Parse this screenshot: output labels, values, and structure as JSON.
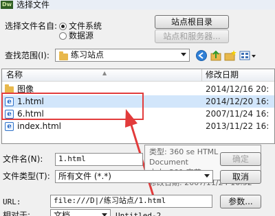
{
  "window": {
    "app_icon": "Dw",
    "title": "选择文件"
  },
  "source": {
    "label": "选择文件名自:",
    "options": [
      "文件系统",
      "数据源"
    ],
    "selected": 0,
    "site_root_button": "站点根目录",
    "site_server_button": "站点和服务器..."
  },
  "lookin": {
    "label": "查找范围(I):",
    "value": "练习站点"
  },
  "toolbar": {
    "icons": [
      "back-icon",
      "up-folder-icon",
      "new-folder-icon",
      "view-menu-icon"
    ]
  },
  "list": {
    "columns": [
      "名称",
      "修改日期"
    ],
    "rows": [
      {
        "name": "图像",
        "date": "2014/12/16 20:",
        "type": "folder"
      },
      {
        "name": "1.html",
        "date": "2014/12/20 16:",
        "type": "html"
      },
      {
        "name": "6.html",
        "date": "2007/11/24 16:",
        "type": "html"
      },
      {
        "name": "index.html",
        "date": "2013/11/22 16:",
        "type": "html"
      }
    ]
  },
  "tooltip": {
    "type_line": "类型: 360 se HTML Document",
    "size_line": "大小: 291 字节",
    "date_line": "修改日期: 2007/11/24 16:52"
  },
  "filename": {
    "label": "文件名(N):",
    "value": "1.html",
    "confirm_button": "确定"
  },
  "filetype": {
    "label": "文件类型(T):",
    "value": "所有文件 (*.*)",
    "cancel_button": "取消"
  },
  "url": {
    "label": "URL:",
    "value": "file:///D|/练习站点/1.html",
    "params_button": "参数..."
  },
  "relative": {
    "label": "相对于:",
    "value": "文档",
    "doc_name": "Untitled-2"
  },
  "colors": {
    "highlight": "#e23b3b",
    "selection": "#d2e6fb"
  }
}
